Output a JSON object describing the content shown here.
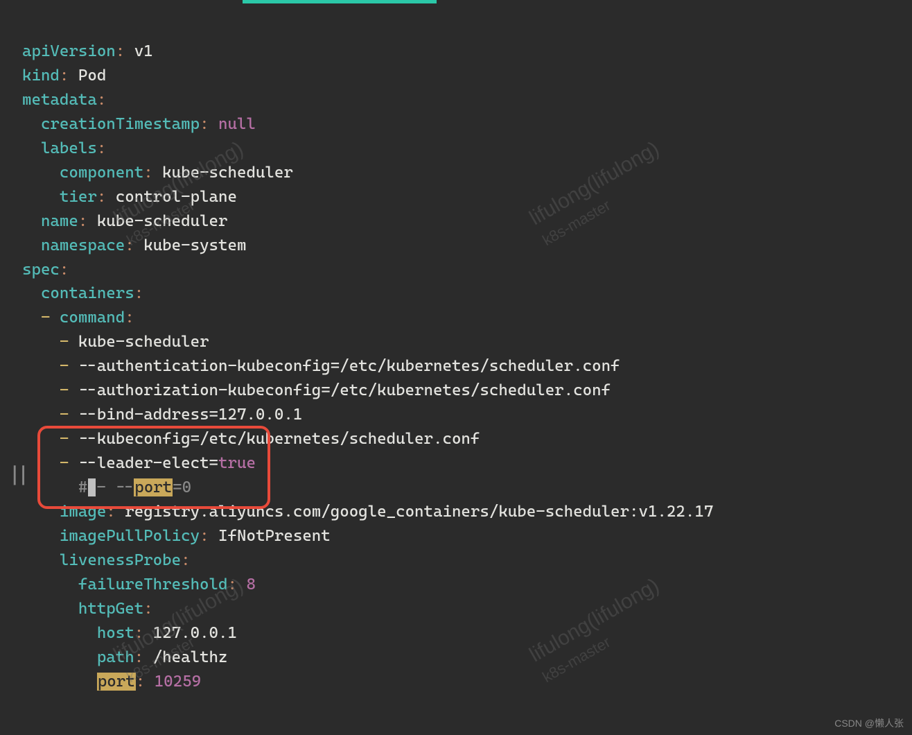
{
  "yaml": {
    "apiVersion_key": "apiVersion",
    "apiVersion_val": "v1",
    "kind_key": "kind",
    "kind_val": "Pod",
    "metadata_key": "metadata",
    "creationTimestamp_key": "creationTimestamp",
    "creationTimestamp_val": "null",
    "labels_key": "labels",
    "component_key": "component",
    "component_val": "kube-scheduler",
    "tier_key": "tier",
    "tier_val": "control-plane",
    "name_key": "name",
    "name_val": "kube-scheduler",
    "namespace_key": "namespace",
    "namespace_val": "kube-system",
    "spec_key": "spec",
    "containers_key": "containers",
    "command_key": "command",
    "cmd0": "kube-scheduler",
    "cmd1": "--authentication-kubeconfig=/etc/kubernetes/scheduler.conf",
    "cmd2": "--authorization-kubeconfig=/etc/kubernetes/scheduler.conf",
    "cmd3": "--bind-address=127.0.0.1",
    "cmd4": "--kubeconfig=/etc/kubernetes/scheduler.conf",
    "cmd5a": "--leader-elect=",
    "cmd5b": "true",
    "comment_hash": "#",
    "comment_dash": "- --",
    "comment_port": "port",
    "comment_eq0": "=0",
    "image_key": "image",
    "image_val": "registry.aliyuncs.com/google_containers/kube-scheduler:v1.22.17",
    "imagePullPolicy_key": "imagePullPolicy",
    "imagePullPolicy_val": "IfNotPresent",
    "livenessProbe_key": "livenessProbe",
    "failureThreshold_key": "failureThreshold",
    "failureThreshold_val": "8",
    "httpGet_key": "httpGet",
    "host_key": "host",
    "host_val": "127.0.0.1",
    "path_key": "path",
    "path_val": "/healthz",
    "port_key": "port",
    "port_val": "10259"
  },
  "watermark": {
    "line1": "lifulong(lifulong)",
    "line2": "k8s-master"
  },
  "attribution": "CSDN @懒人张",
  "fold": "||"
}
